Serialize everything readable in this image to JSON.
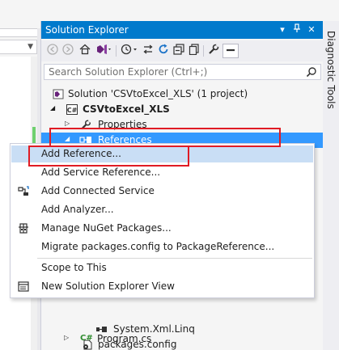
{
  "solution_explorer": {
    "title": "Solution Explorer",
    "search_placeholder": "Search Solution Explorer (Ctrl+;)"
  },
  "side_tab": {
    "label": "Diagnostic Tools"
  },
  "tree": {
    "solution": "Solution 'CSVtoExcel_XLS' (1 project)",
    "project": "CSVtoExcel_XLS",
    "properties": "Properties",
    "references": "References",
    "system_xml_linq": "System.Xml.Linq",
    "packages_config": "packages.config",
    "program_cs": "Program.cs"
  },
  "context_menu": {
    "add_reference": "Add Reference...",
    "add_service_reference": "Add Service Reference...",
    "add_connected_service": "Add Connected Service",
    "add_analyzer": "Add Analyzer...",
    "manage_nuget": "Manage NuGet Packages...",
    "migrate_packages": "Migrate packages.config to PackageReference...",
    "scope_to_this": "Scope to This",
    "new_solution_explorer_view": "New Solution Explorer View"
  },
  "colors": {
    "title_bar": "#007acc",
    "selection": "#3399ff",
    "menu_highlight": "#c9def5",
    "annotation_red": "#e01b24"
  },
  "icons": {
    "toolbar": [
      "back-icon",
      "forward-icon",
      "home-icon",
      "vs-switch-views-icon",
      "history-icon",
      "sync-icon",
      "refresh-icon",
      "collapse-all-icon",
      "show-all-files-icon",
      "properties-wrench-icon",
      "preview-icon"
    ],
    "titlebar": [
      "dropdown-icon",
      "pin-icon",
      "close-icon"
    ]
  }
}
